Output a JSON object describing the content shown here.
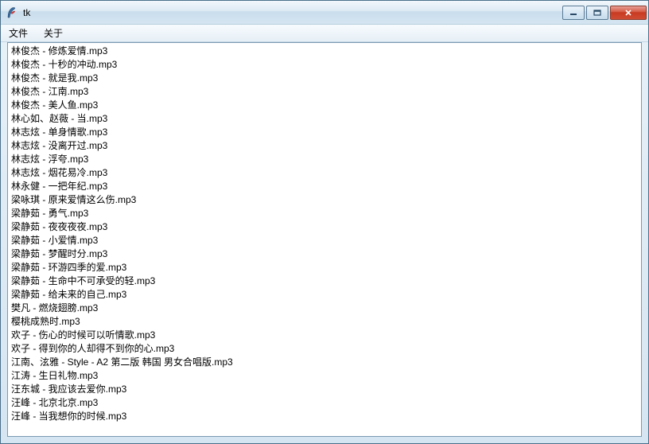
{
  "window": {
    "title": "tk"
  },
  "menu": {
    "file": "文件",
    "about": "关于"
  },
  "files": [
    "林俊杰 - 修炼爱情.mp3",
    "林俊杰 - 十秒的冲动.mp3",
    "林俊杰 - 就是我.mp3",
    "林俊杰 - 江南.mp3",
    "林俊杰 - 美人鱼.mp3",
    "林心如、赵薇 - 当.mp3",
    "林志炫 - 单身情歌.mp3",
    "林志炫 - 没离开过.mp3",
    "林志炫 - 浮夸.mp3",
    "林志炫 - 烟花易冷.mp3",
    "林永健 - 一把年纪.mp3",
    "梁咏琪 - 原来爱情这么伤.mp3",
    "梁静茹 - 勇气.mp3",
    "梁静茹 - 夜夜夜夜.mp3",
    "梁静茹 - 小爱情.mp3",
    "梁静茹 - 梦醒时分.mp3",
    "梁静茹 - 环游四季的爱.mp3",
    "梁静茹 - 生命中不可承受的轻.mp3",
    "梁静茹 - 给未来的自己.mp3",
    "樊凡 - 燃烧翅膀.mp3",
    "樱桃成熟时.mp3",
    "欢子 - 伤心的时候可以听情歌.mp3",
    "欢子 - 得到你的人却得不到你的心.mp3",
    "江南、泫雅 - Style - A2 第二版 韩国 男女合唱版.mp3",
    "江涛 - 生日礼物.mp3",
    "汪东城 - 我应该去爱你.mp3",
    "汪峰 - 北京北京.mp3",
    "汪峰 - 当我想你的时候.mp3"
  ]
}
